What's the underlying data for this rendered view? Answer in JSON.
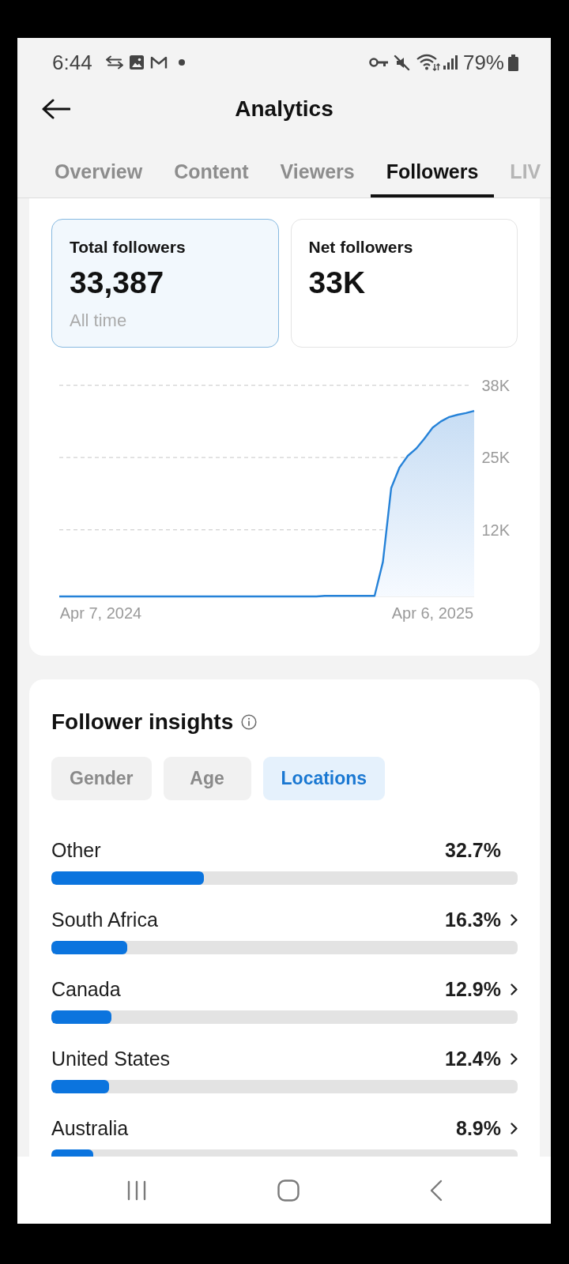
{
  "status_bar": {
    "time": "6:44",
    "battery": "79%"
  },
  "header": {
    "title": "Analytics"
  },
  "tabs": [
    {
      "label": "Overview",
      "selected": false
    },
    {
      "label": "Content",
      "selected": false
    },
    {
      "label": "Viewers",
      "selected": false
    },
    {
      "label": "Followers",
      "selected": true
    },
    {
      "label": "LIV",
      "selected": false
    }
  ],
  "metrics": [
    {
      "label": "Total followers",
      "value": "33,387",
      "note": "All time",
      "selected": true
    },
    {
      "label": "Net followers",
      "value": "33K",
      "selected": false
    }
  ],
  "followers_chart": {
    "chart_data": {
      "type": "area",
      "categories": [
        null,
        null,
        null,
        null,
        null,
        "Apr 7, 2024",
        null,
        null,
        null,
        null,
        null,
        null,
        null,
        null,
        null,
        null,
        null,
        null,
        null,
        null,
        null,
        null,
        null,
        null,
        null,
        null,
        null,
        null,
        null,
        null,
        null,
        null,
        null,
        null,
        null,
        null,
        null,
        null,
        null,
        null,
        null,
        null,
        null,
        null,
        null,
        "Apr 6, 2025",
        null,
        null,
        null,
        null,
        null
      ],
      "values": [
        0,
        0,
        0,
        0,
        0,
        0,
        0,
        0,
        0,
        0,
        0,
        0,
        0,
        0,
        0,
        0,
        0,
        0,
        0,
        0,
        0,
        0,
        0,
        0,
        0,
        0,
        0,
        0,
        0,
        0,
        0,
        0,
        0.1,
        0.1,
        0.1,
        0.1,
        0.1,
        0.1,
        0.1,
        6.2,
        19.5,
        23.2,
        25.3,
        26.6,
        28.4,
        30.4,
        31.5,
        32.3,
        32.7,
        33,
        33.4
      ],
      "ylim": [
        0,
        38
      ],
      "yticks": [
        {
          "value": 12,
          "label": "12K"
        },
        {
          "value": 25,
          "label": "25K"
        },
        {
          "value": 38,
          "label": "38K"
        }
      ]
    }
  },
  "insights": {
    "title": "Follower insights",
    "filters": [
      {
        "label": "Gender",
        "selected": false
      },
      {
        "label": "Age",
        "selected": false
      },
      {
        "label": "Locations",
        "selected": true
      }
    ],
    "locations": [
      {
        "name": "Other",
        "share": "32.7%",
        "level": 0.327,
        "has_details": false
      },
      {
        "name": "South Africa",
        "share": "16.3%",
        "level": 0.163,
        "has_details": true
      },
      {
        "name": "Canada",
        "share": "12.9%",
        "level": 0.129,
        "has_details": true
      },
      {
        "name": "United States",
        "share": "12.4%",
        "level": 0.124,
        "has_details": true
      },
      {
        "name": "Australia",
        "share": "8.9%",
        "level": 0.089,
        "has_details": true
      }
    ]
  }
}
